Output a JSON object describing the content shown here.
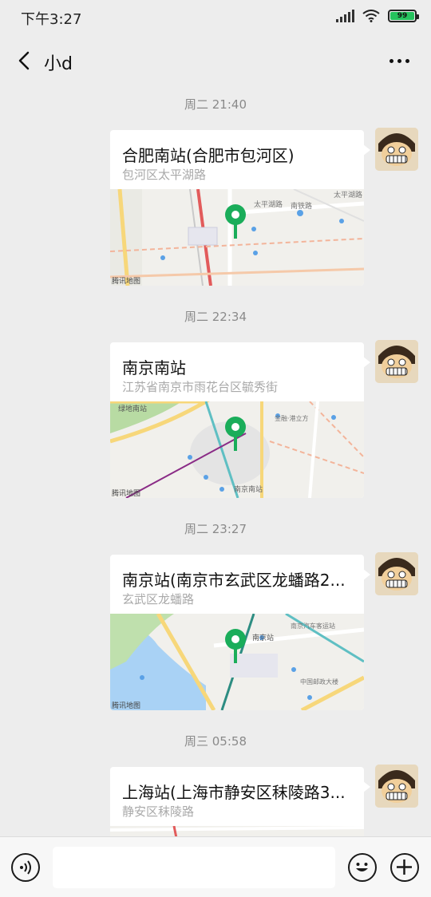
{
  "status_bar": {
    "time": "下午3:27",
    "battery_level": "99",
    "battery_color": "#25c25d"
  },
  "header": {
    "title": "小d",
    "back_icon": "chevron-left-icon",
    "more_icon": "more-dots-icon"
  },
  "messages": [
    {
      "timestamp": "周二 21:40",
      "title": "合肥南站(合肥市包河区)",
      "subtitle": "包河区太平湖路",
      "map_labels": [
        "太平湖路",
        "南铁路",
        "太平湖路"
      ],
      "map_watermark": "腾讯地图"
    },
    {
      "timestamp": "周二 22:34",
      "title": "南京南站",
      "subtitle": "江苏省南京市雨花台区毓秀街",
      "map_labels": [
        "绿地南站",
        "金融·港立方",
        "南京南站"
      ],
      "map_watermark": "腾讯地图"
    },
    {
      "timestamp": "周二 23:27",
      "title": "南京站(南京市玄武区龙蟠路2...",
      "subtitle": "玄武区龙蟠路",
      "map_labels": [
        "南京站",
        "南京汽车客运站",
        "中国邮政大楼"
      ],
      "map_watermark": "腾讯地图"
    },
    {
      "timestamp": "周三 05:58",
      "title": "上海站(上海市静安区秣陵路3...",
      "subtitle": "静安区秣陵路",
      "map_labels": [],
      "map_watermark": ""
    }
  ],
  "input_bar": {
    "voice_icon": "voice-icon",
    "input_value": "",
    "emoji_icon": "emoji-icon",
    "plus_icon": "plus-icon"
  },
  "colors": {
    "pin": "#1aad5a",
    "background": "#ededed",
    "bubble": "#ffffff"
  }
}
